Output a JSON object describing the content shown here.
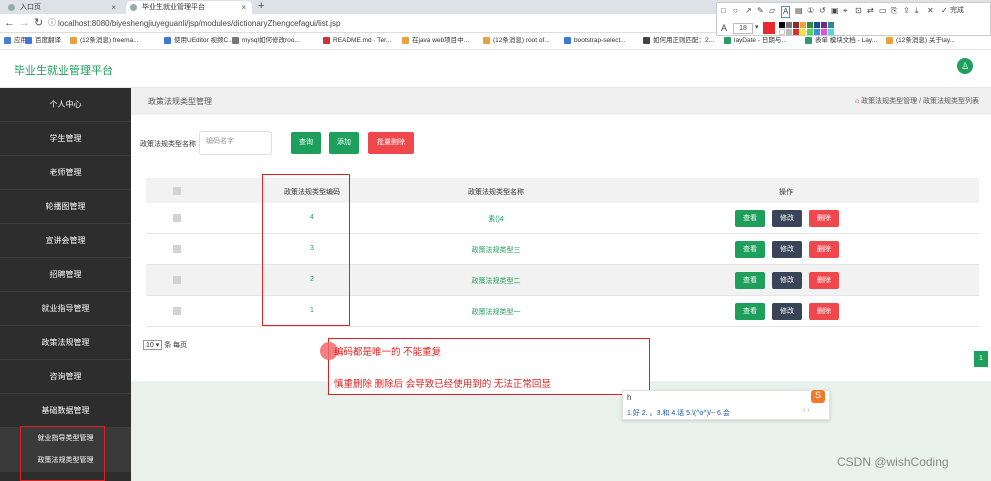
{
  "browser": {
    "tabs": [
      {
        "label": "入口页"
      },
      {
        "label": "毕业生就业管理平台"
      }
    ],
    "url": "localhost:8080/biyeshengjiuyeguanli/jsp/modules/dictionaryZhengcefagui/list.jsp",
    "bookmarks": [
      "应用",
      "百度翻译",
      "(12条消息) freema...",
      "使用UEditor 视频C...",
      "mysql如何修改roo...",
      "README.md · Ter...",
      "在java web项目中...",
      "(12条消息) root of...",
      "bootstrap-select...",
      "如何用正则匹配：2...",
      "layDate - 日期与...",
      "表单 模块文档 - Lay...",
      "(12条消息) 关于lay..."
    ],
    "font_size": "18",
    "finish_label": "完成"
  },
  "app": {
    "brand": "毕业生就业管理平台",
    "sidebar": {
      "items": [
        "个人中心",
        "学生管理",
        "老师管理",
        "轮播图管理",
        "宣讲会管理",
        "招聘管理",
        "就业指导管理",
        "政策法规管理",
        "咨询管理",
        "基础数据管理"
      ],
      "subitems": [
        "就业指导类型管理",
        "政策法规类型管理"
      ]
    },
    "page_title": "政策法规类型管理",
    "breadcrumb": "政策法规类型管理 / 政策法规类型列表",
    "search": {
      "label": "政策法规类型名称",
      "placeholder": "编码名字"
    },
    "buttons": {
      "query": "查询",
      "add": "添加",
      "batch_delete": "批量删除"
    },
    "table": {
      "headers": [
        "政策法规类型编码",
        "政策法规类型名称",
        "操作"
      ],
      "rows": [
        {
          "code": "4",
          "name": "素()4"
        },
        {
          "code": "3",
          "name": "政策法规类型三"
        },
        {
          "code": "2",
          "name": "政策法规类型二"
        },
        {
          "code": "1",
          "name": "政策法规类型一"
        }
      ],
      "actions": {
        "view": "查看",
        "edit": "修改",
        "delete": "删除"
      }
    },
    "pager": {
      "per_page": "10",
      "per_page_label": "条 每页",
      "current": "1"
    }
  },
  "annotation": {
    "line1": "编码都是唯一的 不能重复",
    "line2": "慎重删除  删除后 会导致已经使用到的 无法正常回显"
  },
  "ime": {
    "input": "h",
    "candidates": "1.好  2.  。3.和  4.话  5.\\(^o^)/~  6.会"
  },
  "watermark": "CSDN @wishCoding"
}
